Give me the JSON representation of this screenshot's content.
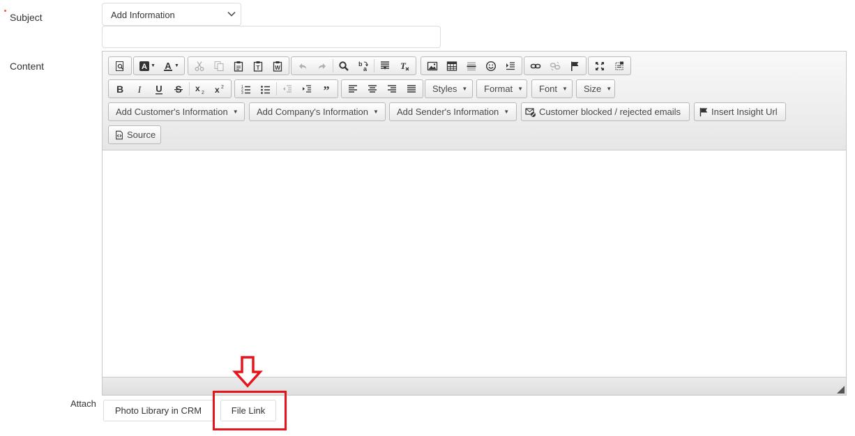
{
  "form": {
    "subject_label": "Subject",
    "subject_select_value": "Add Information",
    "subject_input_value": "",
    "content_label": "Content",
    "attach_label": "Attach"
  },
  "toolbar": {
    "styles": "Styles",
    "format": "Format",
    "font": "Font",
    "size": "Size",
    "add_customer_info": "Add Customer's Information",
    "add_company_info": "Add Company's Information",
    "add_sender_info": "Add Sender's Information",
    "customer_blocked": "Customer blocked / rejected emails",
    "insert_insight_url": "Insert Insight Url",
    "source": "Source"
  },
  "attach": {
    "photo_library": "Photo Library in CRM",
    "file_link": "File Link"
  },
  "colors": {
    "required_marker": "#e8632a",
    "highlight_box": "#e8141c",
    "toolbar_bg": "#e6e6e6"
  },
  "icons": [
    "preview-icon",
    "background-color-icon",
    "text-color-icon",
    "cut-icon",
    "copy-icon",
    "paste-icon",
    "paste-text-icon",
    "paste-word-icon",
    "undo-icon",
    "redo-icon",
    "find-icon",
    "replace-icon",
    "select-all-icon",
    "remove-format-icon",
    "image-icon",
    "table-icon",
    "horizontal-line-icon",
    "smiley-icon",
    "page-break-icon",
    "link-icon",
    "unlink-icon",
    "anchor-icon",
    "maximize-icon",
    "show-blocks-icon",
    "bold-icon",
    "italic-icon",
    "underline-icon",
    "strikethrough-icon",
    "subscript-icon",
    "superscript-icon",
    "numbered-list-icon",
    "bulleted-list-icon",
    "outdent-icon",
    "indent-icon",
    "blockquote-icon",
    "align-left-icon",
    "align-center-icon",
    "align-right-icon",
    "justify-icon",
    "blocked-email-icon",
    "flag-icon",
    "source-icon",
    "chevron-down-icon",
    "arrow-down-icon",
    "resize-grip-icon"
  ]
}
